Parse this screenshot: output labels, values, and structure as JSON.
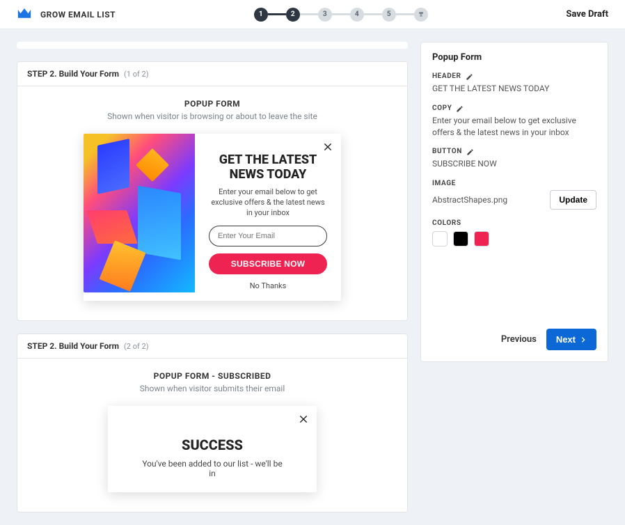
{
  "topbar": {
    "title": "GROW EMAIL LIST",
    "save_draft": "Save Draft",
    "steps": [
      "1",
      "2",
      "3",
      "4",
      "5"
    ]
  },
  "step1": {
    "title": "STEP 2. Build Your Form",
    "meta": "(1 of 2)",
    "section_title": "POPUP FORM",
    "section_sub": "Shown when visitor is browsing or about to leave the site"
  },
  "popup": {
    "headline": "GET THE LATEST NEWS TODAY",
    "copy": "Enter your email below to get exclusive offers & the latest news in your inbox",
    "email_placeholder": "Enter Your Email",
    "button": "SUBSCRIBE NOW",
    "no_thanks": "No Thanks"
  },
  "step2": {
    "title": "STEP 2. Build Your Form",
    "meta": "(2 of 2)",
    "section_title": "POPUP FORM - SUBSCRIBED",
    "section_sub": "Shown when visitor submits their email"
  },
  "success": {
    "headline": "SUCCESS",
    "copy": "You've been added to our list - we'll be in"
  },
  "sidebar": {
    "title": "Popup Form",
    "header_label": "HEADER",
    "header_value": "GET THE LATEST NEWS TODAY",
    "copy_label": "COPY",
    "copy_value": "Enter your email below to get exclusive offers & the latest news in your inbox",
    "button_label": "BUTTON",
    "button_value": "SUBSCRIBE NOW",
    "image_label": "IMAGE",
    "image_value": "AbstractShapes.png",
    "update": "Update",
    "colors_label": "COLORS",
    "colors": [
      "#ffffff",
      "#000000",
      "#ef2351"
    ],
    "previous": "Previous",
    "next": "Next"
  }
}
